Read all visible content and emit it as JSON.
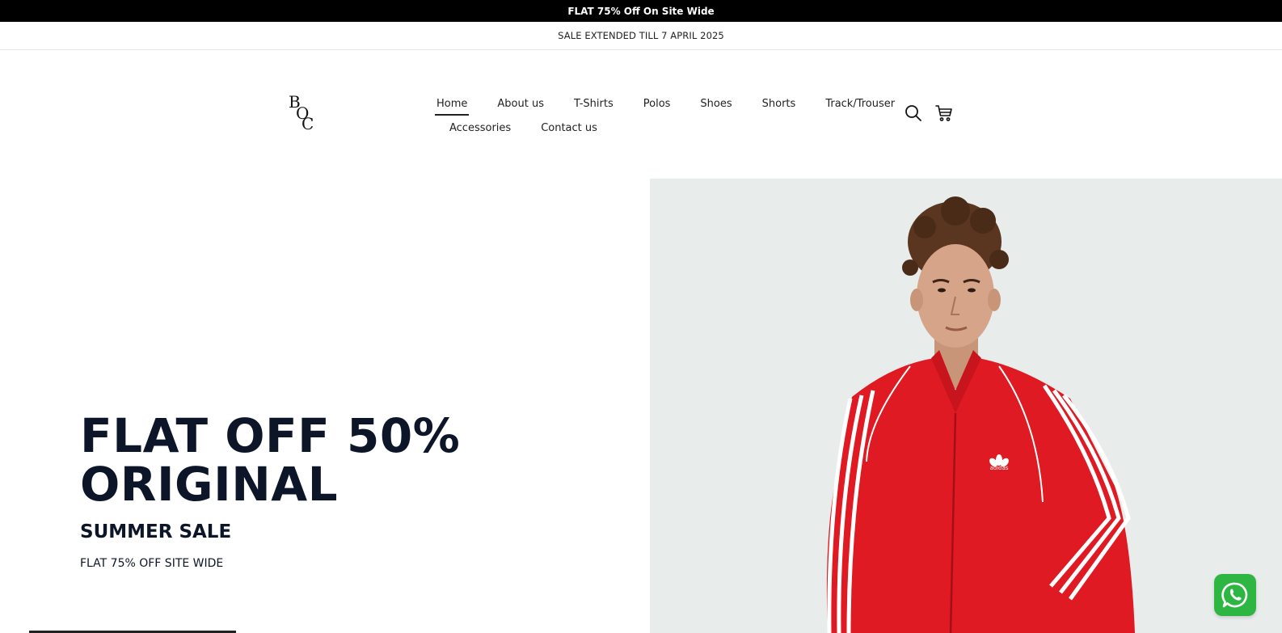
{
  "announcement": {
    "text": "FLAT 75% Off On Site Wide"
  },
  "sub_announcement": {
    "text": "SALE EXTENDED TILL 7 APRIL 2025"
  },
  "logo": {
    "letters": [
      "B",
      "O",
      "C"
    ]
  },
  "nav": {
    "row1": [
      "Home",
      "About us",
      "T-Shirts",
      "Polos",
      "Shoes",
      "Shorts",
      "Track/Trouser"
    ],
    "row2": [
      "Accessories",
      "Contact us"
    ],
    "active": "Home"
  },
  "header_icons": [
    "search-icon",
    "cart-icon"
  ],
  "hero": {
    "headline_line1": "FLAT OFF 50%",
    "headline_line2": "ORIGINAL",
    "subheading": "SUMMER SALE",
    "tagline": "FLAT 75% OFF SITE WIDE",
    "image_background": "#e8edec",
    "jacket_color": "#e01a22",
    "brand_mark": "adidas"
  },
  "floating": {
    "icon": "whatsapp-icon",
    "color": "#2db742"
  },
  "colors": {
    "headline": "#0d1528",
    "topbar": "#000000"
  }
}
